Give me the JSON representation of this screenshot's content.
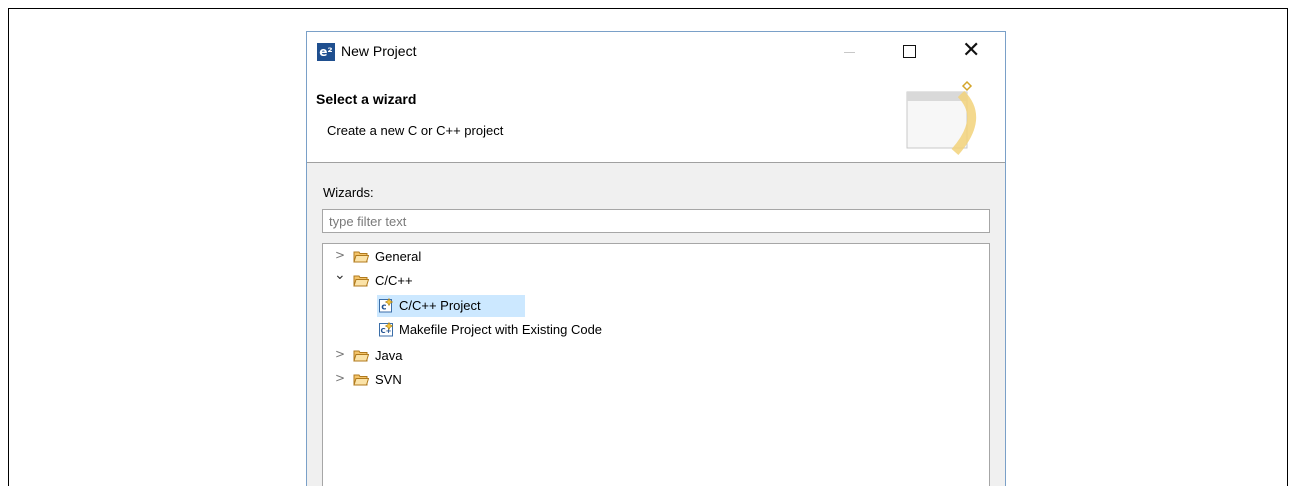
{
  "window": {
    "title": "New Project",
    "app_icon": "e²",
    "close_glyph": "✕"
  },
  "banner": {
    "title": "Select a wizard",
    "description": "Create a new C or C++ project"
  },
  "wizards": {
    "label": "Wizards:",
    "filter_placeholder": "type filter text",
    "filter_value": ""
  },
  "tree": [
    {
      "label": "General",
      "expanded": false,
      "chevron": ">"
    },
    {
      "label": "C/C++",
      "expanded": true,
      "chevron": "⌄"
    },
    {
      "label": "C/C++ Project",
      "selected": true
    },
    {
      "label": "Makefile Project with Existing Code",
      "selected": false
    },
    {
      "label": "Java",
      "expanded": false,
      "chevron": ">"
    },
    {
      "label": "SVN",
      "expanded": false,
      "chevron": ">"
    }
  ],
  "colors": {
    "selection": "#cce8ff",
    "folder": "#e8a33c",
    "app_icon_bg": "#1f4f8f",
    "banner_arc": "#f2d27a"
  },
  "icons": [
    "app-logo-icon",
    "minimize-icon",
    "maximize-icon",
    "close-icon",
    "wizard-banner-icon",
    "folder-icon",
    "c-project-icon",
    "makefile-project-icon",
    "chevron-right-icon",
    "chevron-down-icon"
  ]
}
